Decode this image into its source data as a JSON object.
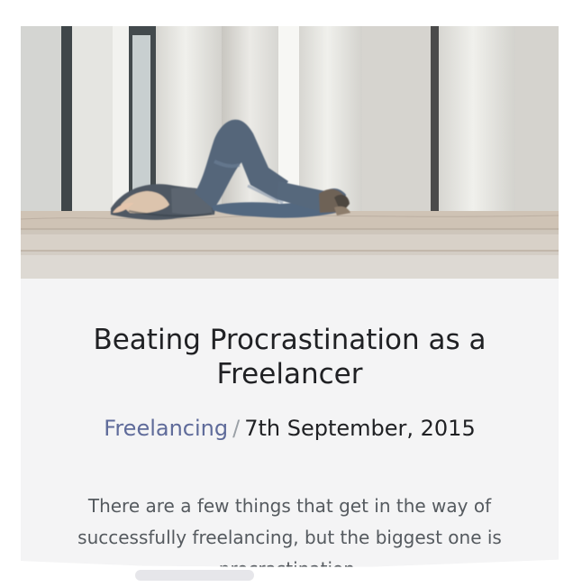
{
  "article": {
    "title": "Beating Procrastination as a Freelancer",
    "category": "Freelancing",
    "separator": "/",
    "date": "7th September, 2015",
    "excerpt": "There are a few things that get in the way of successfully freelancing, but the biggest one is procrastination."
  },
  "colors": {
    "card_background": "#f4f4f5",
    "title": "#202124",
    "category_link": "#5f6b9a",
    "separator": "#9aa0a6",
    "excerpt": "#555a5f"
  },
  "icons": {
    "hero_image": "man-lying-on-steps-photo"
  }
}
